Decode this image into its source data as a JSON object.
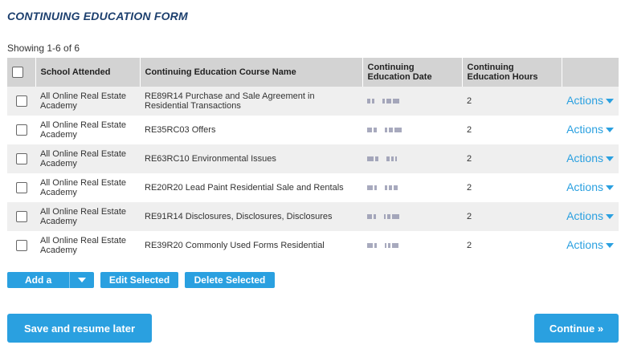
{
  "form": {
    "title": "CONTINUING EDUCATION FORM",
    "showing": "Showing 1-6 of 6"
  },
  "table": {
    "columns": [
      "School Attended",
      "Continuing Education Course Name",
      "Continuing Education Date",
      "Continuing Education Hours"
    ],
    "rows": [
      {
        "school": "All Online Real Estate Academy",
        "course": "RE89R14 Purchase and Sale Agreement in Residential Transactions",
        "hours": "2",
        "actions": "Actions"
      },
      {
        "school": "All Online Real Estate Academy",
        "course": "RE35RC03 Offers",
        "hours": "2",
        "actions": "Actions"
      },
      {
        "school": "All Online Real Estate Academy",
        "course": "RE63RC10 Environmental Issues",
        "hours": "2",
        "actions": "Actions"
      },
      {
        "school": "All Online Real Estate Academy",
        "course": "RE20R20 Lead Paint Residential Sale and Rentals",
        "hours": "2",
        "actions": "Actions"
      },
      {
        "school": "All Online Real Estate Academy",
        "course": "RE91R14 Disclosures, Disclosures, Disclosures",
        "hours": "2",
        "actions": "Actions"
      },
      {
        "school": "All Online Real Estate Academy",
        "course": "RE39R20 Commonly Used Forms Residential",
        "hours": "2",
        "actions": "Actions"
      }
    ]
  },
  "buttons": {
    "add_row": "Add a Row",
    "edit_selected": "Edit Selected",
    "delete_selected": "Delete Selected",
    "save_resume": "Save and resume later",
    "continue": "Continue »"
  },
  "colors": {
    "accent": "#2aa0e0",
    "title": "#1c3f6e",
    "header_bg": "#d3d3d3",
    "row_alt": "#efefef"
  }
}
